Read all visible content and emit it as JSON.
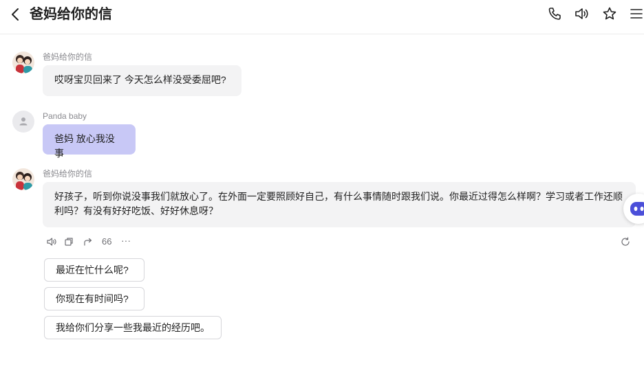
{
  "header": {
    "title": "爸妈给你的信",
    "icons": [
      "back-icon",
      "phone-icon",
      "speaker-icon",
      "star-icon",
      "menu-icon"
    ]
  },
  "messages": [
    {
      "sender": "爸妈给你的信",
      "role": "bot",
      "text": "哎呀宝贝回来了 今天怎么样没受委屈吧?"
    },
    {
      "sender": "Panda baby",
      "role": "user",
      "text": "爸妈 放心我没事"
    },
    {
      "sender": "爸妈给你的信",
      "role": "bot",
      "text": "好孩子，听到你说没事我们就放心了。在外面一定要照顾好自己，有什么事情随时跟我们说。你最近过得怎么样啊？学习或者工作还顺利吗？有没有好好吃饭、好好休息呀？"
    }
  ],
  "actions": {
    "icons": [
      "speaker-icon",
      "copy-icon",
      "share-icon",
      "quote-icon",
      "more-icon",
      "regenerate-icon"
    ],
    "quote_label": "66",
    "more_label": "···"
  },
  "suggestions": [
    "最近在忙什么呢?",
    "你现在有时间吗?",
    "我给你们分享一些我最近的经历吧。"
  ],
  "colors": {
    "user_bubble": "#c8c8f6",
    "bot_bubble": "#f3f3f4",
    "suggestion_border": "#d6d6da"
  }
}
